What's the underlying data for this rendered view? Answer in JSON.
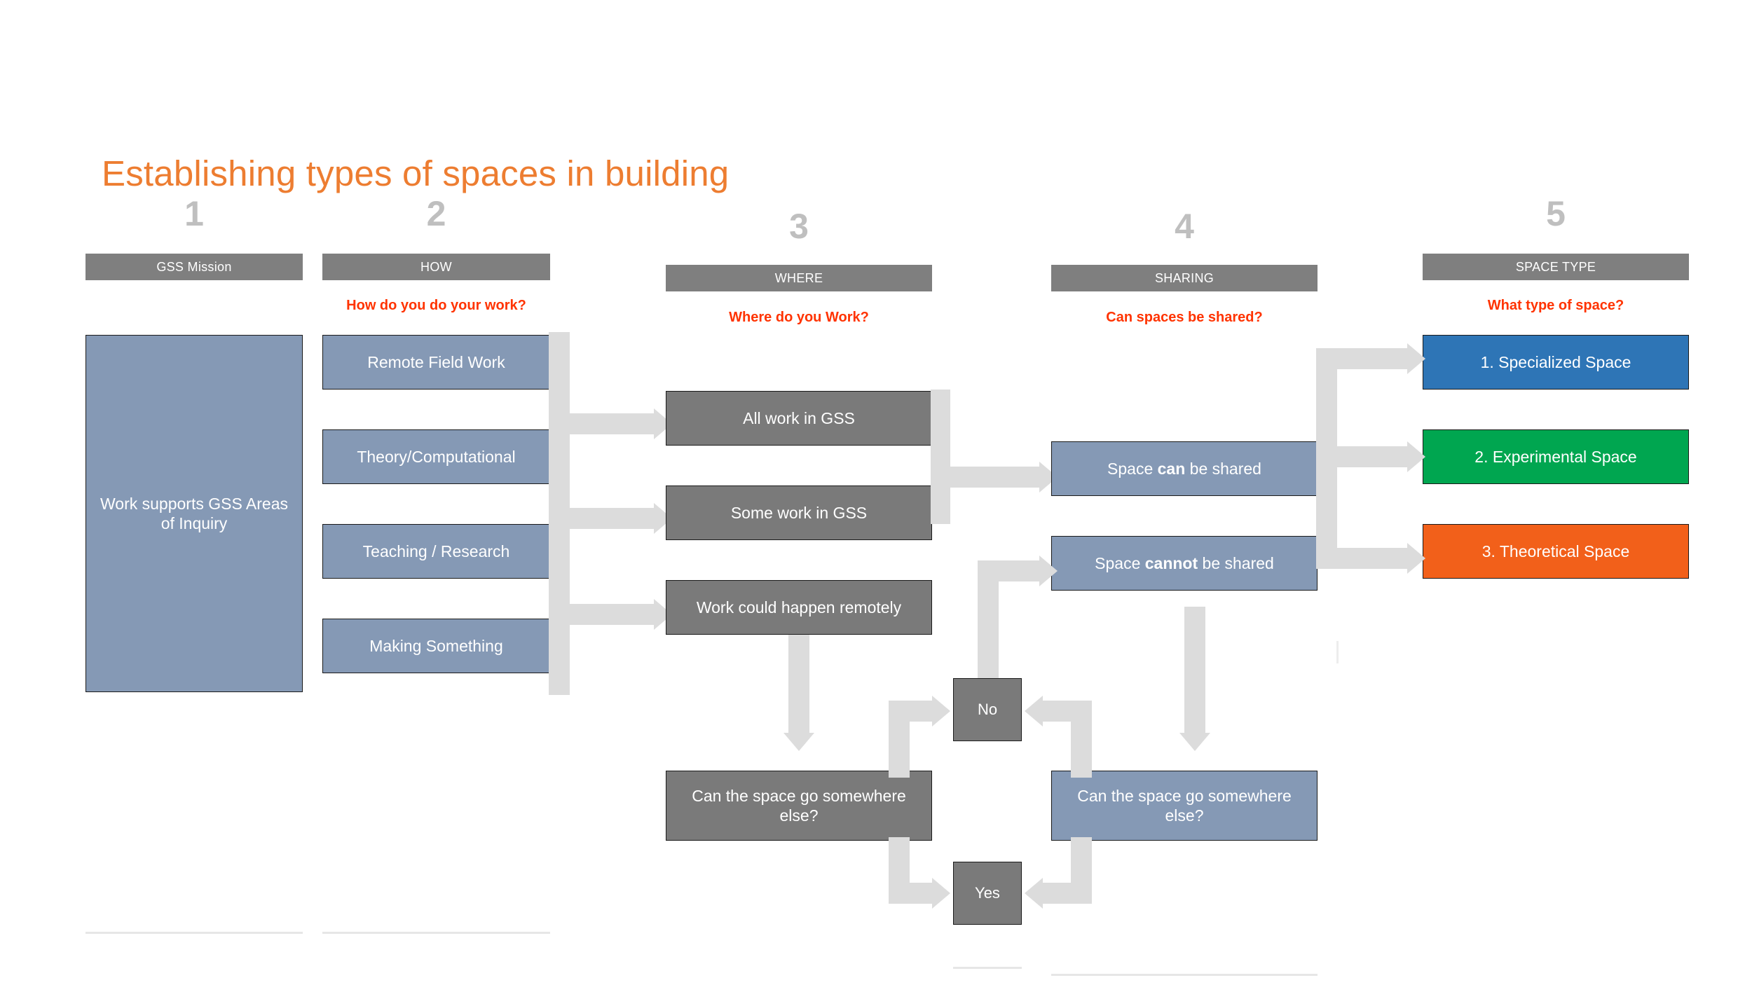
{
  "title": "Establishing types of spaces in building",
  "columns": [
    {
      "number": "1",
      "header": "GSS Mission",
      "question": ""
    },
    {
      "number": "2",
      "header": "HOW",
      "question": "How do you do your work?"
    },
    {
      "number": "3",
      "header": "WHERE",
      "question": "Where do you Work?"
    },
    {
      "number": "4",
      "header": "SHARING",
      "question": "Can spaces be shared?"
    },
    {
      "number": "5",
      "header": "SPACE TYPE",
      "question": "What type of space?"
    }
  ],
  "mission": {
    "text": "Work supports GSS Areas of Inquiry"
  },
  "how_boxes": [
    {
      "label": "Remote Field Work"
    },
    {
      "label": "Theory/Computational"
    },
    {
      "label": "Teaching / Research"
    },
    {
      "label": "Making Something"
    }
  ],
  "where_boxes": [
    {
      "label": "All work in GSS"
    },
    {
      "label": "Some work in GSS"
    },
    {
      "label": "Work could happen remotely"
    }
  ],
  "sharing_boxes": [
    {
      "prefix": "Space ",
      "emphasis": "can",
      "suffix": " be shared"
    },
    {
      "prefix": "Space ",
      "emphasis": "cannot",
      "suffix": " be shared"
    }
  ],
  "space_types": [
    {
      "label": "1. Specialized Space",
      "color": "#2E75B6"
    },
    {
      "label": "2. Experimental Space",
      "color": "#00A650"
    },
    {
      "label": "3. Theoretical Space",
      "color": "#F2601A"
    }
  ],
  "decision": {
    "question_left": "Can the space go somewhere else?",
    "question_right": "Can the space go somewhere else?",
    "no_label": "No",
    "yes_label": "Yes"
  },
  "colors": {
    "title": "#ED7D31",
    "step_number": "#BFBFBF",
    "header_bar": "#7F7F7F",
    "red_caption": "#FF3300",
    "blue_grey_box": "#8599B5",
    "grey_box": "#7A7A7A",
    "connector": "#DCDCDC",
    "specialized": "#2E75B6",
    "experimental": "#00A650",
    "theoretical": "#F2601A"
  }
}
